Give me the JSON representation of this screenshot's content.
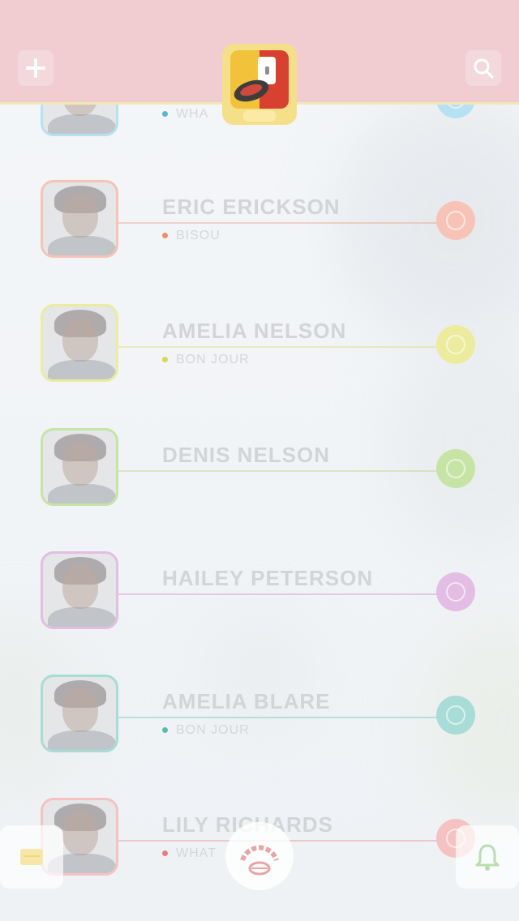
{
  "header": {
    "add_icon": "plus-icon",
    "search_icon": "search-icon",
    "logo": "app-logo",
    "logo_colors": [
      "#f2c23a",
      "#d8402f"
    ]
  },
  "contacts": [
    {
      "name": "",
      "status": "WHA",
      "color": "#b5e1f2",
      "dot": "#5ab4d6"
    },
    {
      "name": "ERIC ERICKSON",
      "status": "BISOU",
      "color": "#f6c3b6",
      "dot": "#ef8c69"
    },
    {
      "name": "AMELIA NELSON",
      "status": "BON JOUR",
      "color": "#ecec9c",
      "dot": "#dad84e"
    },
    {
      "name": "DENIS NELSON",
      "status": "",
      "color": "#c6e4a4",
      "dot": "#a4d06c"
    },
    {
      "name": "HAILEY PETERSON",
      "status": "",
      "color": "#e3bde3",
      "dot": "#c47fc6"
    },
    {
      "name": "AMELIA BLARE",
      "status": "BON JOUR",
      "color": "#a8dcd6",
      "dot": "#55bdb0"
    },
    {
      "name": "LILY RICHARDS",
      "status": "WHAT",
      "color": "#f5c2c2",
      "dot": "#e97c7c"
    }
  ],
  "bottom_bar": {
    "chat_icon": "chat-icon",
    "center_icon": "lips-stamp-icon",
    "bell_icon": "bell-icon",
    "accent_yellow": "#f6e7a8",
    "accent_green": "#b7dfae",
    "accent_red": "#e9a4a4"
  }
}
